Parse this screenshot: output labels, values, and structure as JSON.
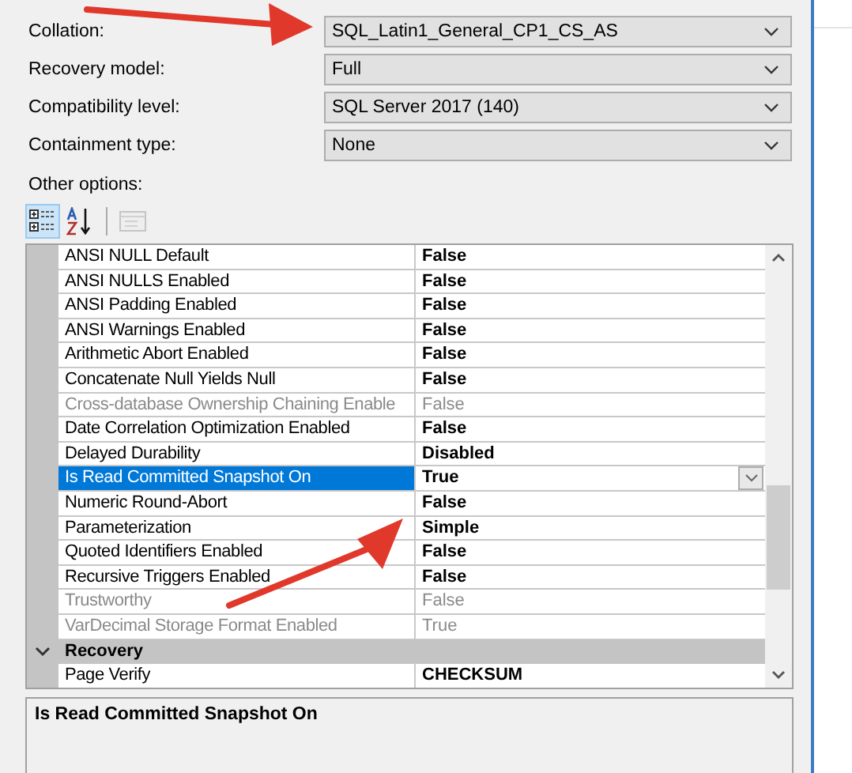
{
  "fields": [
    {
      "label": "Collation:",
      "value": "SQL_Latin1_General_CP1_CS_AS"
    },
    {
      "label": "Recovery model:",
      "value": "Full"
    },
    {
      "label": "Compatibility level:",
      "value": "SQL Server 2017 (140)"
    },
    {
      "label": "Containment type:",
      "value": "None"
    }
  ],
  "other_options_label": "Other options:",
  "toolbar": [
    {
      "kind": "categorized",
      "selected": true,
      "disabled": false
    },
    {
      "kind": "alphabetical",
      "selected": false,
      "disabled": false
    },
    {
      "kind": "property-pages",
      "selected": false,
      "disabled": true
    }
  ],
  "grid": {
    "rows": [
      {
        "kind": "property",
        "name": "ANSI NULL Default",
        "value": "False",
        "disabled": false,
        "selected": false
      },
      {
        "kind": "property",
        "name": "ANSI NULLS Enabled",
        "value": "False",
        "disabled": false,
        "selected": false
      },
      {
        "kind": "property",
        "name": "ANSI Padding Enabled",
        "value": "False",
        "disabled": false,
        "selected": false
      },
      {
        "kind": "property",
        "name": "ANSI Warnings Enabled",
        "value": "False",
        "disabled": false,
        "selected": false
      },
      {
        "kind": "property",
        "name": "Arithmetic Abort Enabled",
        "value": "False",
        "disabled": false,
        "selected": false
      },
      {
        "kind": "property",
        "name": "Concatenate Null Yields Null",
        "value": "False",
        "disabled": false,
        "selected": false
      },
      {
        "kind": "property",
        "name": "Cross-database Ownership Chaining Enable",
        "value": "False",
        "disabled": true,
        "selected": false
      },
      {
        "kind": "property",
        "name": "Date Correlation Optimization Enabled",
        "value": "False",
        "disabled": false,
        "selected": false
      },
      {
        "kind": "property",
        "name": "Delayed Durability",
        "value": "Disabled",
        "disabled": false,
        "selected": false
      },
      {
        "kind": "property",
        "name": "Is Read Committed Snapshot On",
        "value": "True",
        "disabled": false,
        "selected": true
      },
      {
        "kind": "property",
        "name": "Numeric Round-Abort",
        "value": "False",
        "disabled": false,
        "selected": false
      },
      {
        "kind": "property",
        "name": "Parameterization",
        "value": "Simple",
        "disabled": false,
        "selected": false
      },
      {
        "kind": "property",
        "name": "Quoted Identifiers Enabled",
        "value": "False",
        "disabled": false,
        "selected": false
      },
      {
        "kind": "property",
        "name": "Recursive Triggers Enabled",
        "value": "False",
        "disabled": false,
        "selected": false
      },
      {
        "kind": "property",
        "name": "Trustworthy",
        "value": "False",
        "disabled": true,
        "selected": false
      },
      {
        "kind": "property",
        "name": "VarDecimal Storage Format Enabled",
        "value": "True",
        "disabled": true,
        "selected": false
      },
      {
        "kind": "category",
        "name": "Recovery",
        "expanded": true
      },
      {
        "kind": "property",
        "name": "Page Verify",
        "value": "CHECKSUM",
        "disabled": false,
        "selected": false
      }
    ]
  },
  "description": "Is Read Committed Snapshot On"
}
